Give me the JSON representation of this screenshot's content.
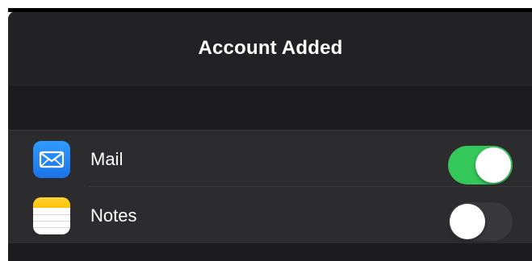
{
  "nav": {
    "title": "Account Added"
  },
  "services": [
    {
      "label": "Mail",
      "icon": "mail-icon",
      "enabled": true
    },
    {
      "label": "Notes",
      "icon": "notes-icon",
      "enabled": false
    }
  ],
  "colors": {
    "background": "#1c1c1e",
    "row_background": "#2c2c2e",
    "toggle_on": "#34c759",
    "toggle_off": "#39393d",
    "mail_icon": "#1a73e8",
    "notes_icon_top": "#ffc107"
  }
}
